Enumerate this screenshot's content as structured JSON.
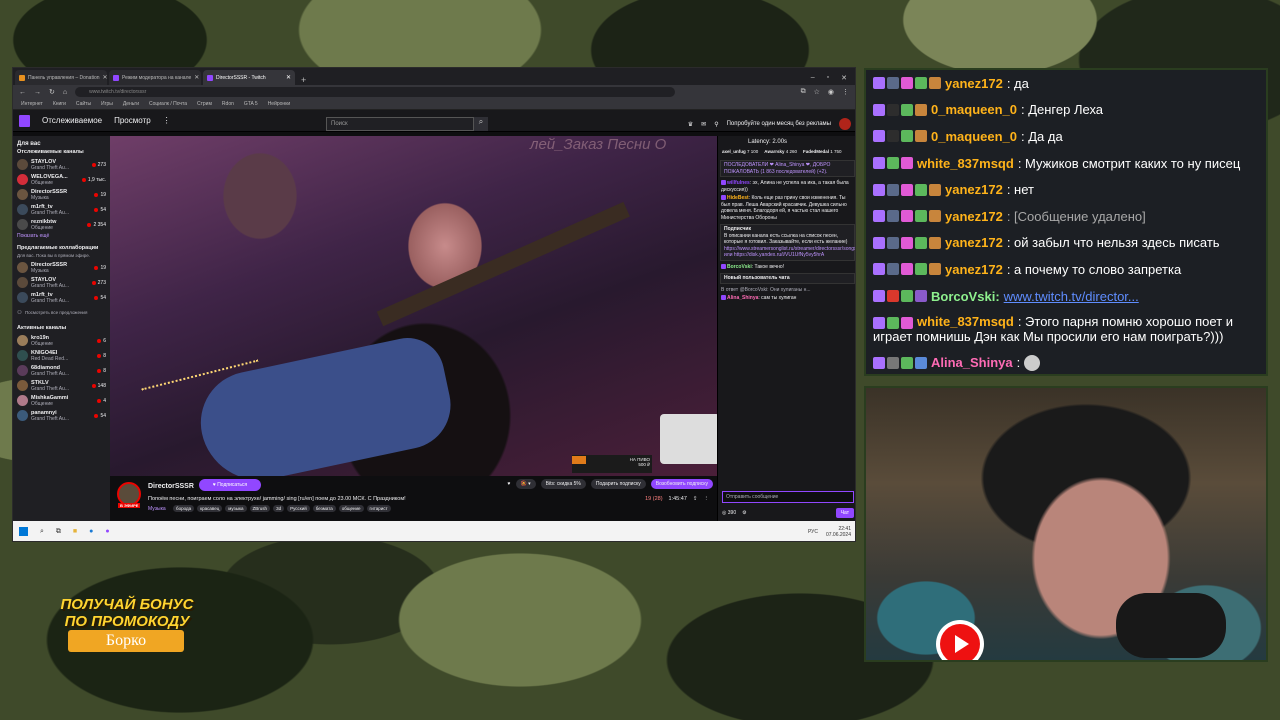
{
  "browser": {
    "tabs": [
      {
        "label": "Панель управления – Donation",
        "color": "#e8911f"
      },
      {
        "label": "Режим модератора на канале",
        "color": "#9147ff"
      },
      {
        "label": "DirectorSSSR - Twitch",
        "color": "#9147ff"
      }
    ],
    "url": "www.twitch.tv/directorsssr",
    "bookmarks": [
      "Интернет",
      "Книги",
      "Сайты",
      "Игры",
      "Деньги",
      "Социалк / Почта",
      "Стрим",
      "Rdon",
      "GTA 5",
      "Нейронки"
    ]
  },
  "twitch": {
    "nav": {
      "following": "Отслеживаемое",
      "browse": "Просмотр",
      "search_placeholder": "Поиск",
      "promo": "Попробуйте один месяц без рекламы"
    },
    "sidebar": {
      "for_you": "Для вас",
      "followed_header": "Отслеживаемые каналы",
      "followed": [
        {
          "name": "STAYLOV",
          "game": "Grand Theft Au...",
          "count": "273"
        },
        {
          "name": "WELOVEGA...",
          "game": "Общение",
          "count": "1,9 тыс."
        },
        {
          "name": "DirectorSSSR",
          "game": "Музыка",
          "count": "19"
        },
        {
          "name": "m1rft_tv",
          "game": "Grand Theft Au...",
          "count": "54"
        },
        {
          "name": "reznikbtw",
          "game": "Общение",
          "count": "2 354"
        }
      ],
      "show_more": "Показать ещё",
      "collab_header": "Предлагаемые коллаборации",
      "collab_desc": "Для вас. Пока вы в прямом эфире.",
      "collab": [
        {
          "name": "DirectorSSSR",
          "game": "Музыка",
          "count": "19"
        },
        {
          "name": "STAYLOV",
          "game": "Grand Theft Au...",
          "count": "273"
        },
        {
          "name": "m1rft_tv",
          "game": "Grand Theft Au...",
          "count": "54"
        }
      ],
      "see_all": "Посмотреть все предложения",
      "active_header": "Активные каналы",
      "active": [
        {
          "name": "kro19n",
          "game": "Общение",
          "count": "6"
        },
        {
          "name": "KNIGO4EI",
          "game": "Red Dead Red...",
          "count": "8"
        },
        {
          "name": "68diamond",
          "game": "Grand Theft Au...",
          "count": "8"
        },
        {
          "name": "STKLV",
          "game": "Grand Theft Au...",
          "count": "148"
        },
        {
          "name": "MishkaGammi",
          "game": "Общение",
          "count": "4"
        },
        {
          "name": "panamnyi",
          "game": "Grand Theft Au...",
          "count": "54"
        }
      ]
    },
    "stream": {
      "watermark": "лей_Заказ Песни О",
      "donate": "НА ПИВО",
      "donate_amount": "500 ₽",
      "live": "В ЭФИРЕ",
      "channel": "DirectorSSSR",
      "follow": "Подписаться",
      "title": "Попоём песни, поиграем соло на электрухе/ jamming/ sing [ru/en] поем до 23.00 МСК. С Праздником!",
      "category": "Музыка",
      "tags": [
        "борода",
        "красавец",
        "музыка",
        "ZBrush",
        "3d",
        "Русский",
        "безмата",
        "общение",
        "гитарист"
      ],
      "bits": "Bits: скидка 5%",
      "sub": "Подарить подписку",
      "resume": "Возобновить подписку",
      "viewers": "19 (28)",
      "uptime": "1:45:47"
    },
    "chat": {
      "latency": "Latency: 2.00s",
      "gifters": [
        "axel_unfug",
        "Awarrsky",
        "FadedMedal"
      ],
      "gift_counts": [
        "7 100",
        "4 260",
        "1 750"
      ],
      "messages": [
        {
          "name": "",
          "text": "ПОСЛЕДОВАТЕЛИ ❤ Alina_Shinya ❤, ДОБРО ПОЖАЛОВАТЬ (1 863 последователей) (+2).",
          "color": "#efeff1"
        },
        {
          "name": "willfulnes",
          "text": ": эх, Алина не успела на ика, а такая была дискуссия))",
          "color": "#9147ff"
        },
        {
          "name": "HideBest",
          "text": ": Коль еще раз прину свои изменения. Ты был прав. Леша Аварский красавчик. Девушка сильно довела меня. Благодоря ей, я частью стал нашего Министерства Обороны",
          "color": "#ffb31a"
        },
        {
          "name": "BorcoVski",
          "text": ": Такое вечно!",
          "color": "#8ef08e"
        },
        {
          "name": "Alina_Shinya",
          "text": ": сам ты хулиган",
          "color": "#ff6bb5"
        }
      ],
      "sub_box": "Подписчик",
      "sub_text": "В описании канала есть ссылка на список песен, которые я готовил. Заказывайте, если есть желание)",
      "sub_links": "https://www.streamersonglist.ru/streamer/directorsssr/songs или https://disk.yandex.ru/i/VU1UfNy5vy5hrA",
      "new_user": "Новый пользователь чата",
      "reply": "В ответ @BorcoVski: Они хулиганы н...",
      "input_placeholder": "Отправить сообщение",
      "points": "390",
      "chat_button": "Чат"
    }
  },
  "taskbar": {
    "lang": "РУС",
    "time": "22:41",
    "date": "07.06.2024"
  },
  "overlay_chat": [
    {
      "name": "yanez172",
      "text": ": да",
      "color": "#ffb31a"
    },
    {
      "name": "0_maqueen_0",
      "text": ": Денгер Леха",
      "color": "#ffb31a"
    },
    {
      "name": "0_maqueen_0",
      "text": ": Да да",
      "color": "#ffb31a"
    },
    {
      "name": "white_837msqd",
      "text": ": Мужиков смотрит каких то ну писец",
      "color": "#ffb31a"
    },
    {
      "name": "yanez172",
      "text": ": нет",
      "color": "#ffb31a"
    },
    {
      "name": "yanez172",
      "text": ": [Сообщение удалено]",
      "color": "#ffb31a"
    },
    {
      "name": "yanez172",
      "text": ": ой забыл что нельзя здесь писать",
      "color": "#ffb31a"
    },
    {
      "name": "yanez172",
      "text": ": а почему то слово запретка",
      "color": "#ffb31a"
    },
    {
      "name": "BorcoVski",
      "text": "www.twitch.tv/director...",
      "color": "#8ef08e"
    },
    {
      "name": "white_837msqd",
      "text": ": Этого парня помню хорошо поет и играет помнишь Дэн как Мы просили его нам поиграть?)))",
      "color": "#ffb31a"
    },
    {
      "name": "Alina_Shinya",
      "text": ":",
      "color": "#ff6bb5"
    }
  ],
  "promo": {
    "line1": "ПОЛУЧАЙ БОНУС",
    "line2": "ПО ПРОМОКОДУ",
    "code": "Борко"
  },
  "colors": {
    "twitch": "#9147ff",
    "live": "#eb0400",
    "promo": "#f0a623"
  }
}
